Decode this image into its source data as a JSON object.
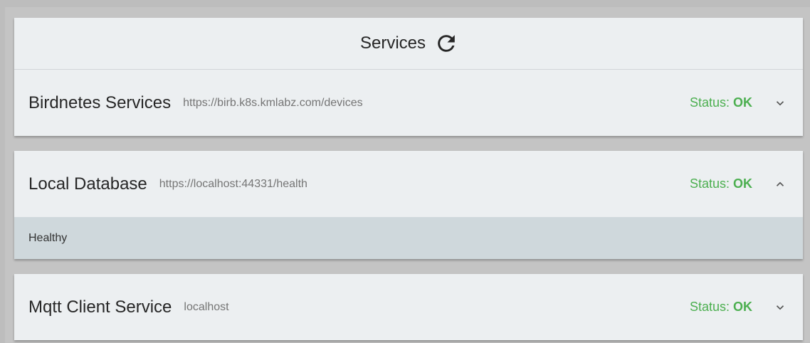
{
  "header": {
    "title": "Services",
    "refresh_icon": "refresh-icon"
  },
  "services": [
    {
      "name": "Birdnetes Services",
      "url": "https://birb.k8s.kmlabz.com/devices",
      "status_label": "Status: ",
      "status_value": "OK",
      "expanded": false,
      "chevron_icon": "chevron-down-icon"
    },
    {
      "name": "Local Database",
      "url": "https://localhost:44331/health",
      "status_label": "Status: ",
      "status_value": "OK",
      "expanded": true,
      "chevron_icon": "chevron-up-icon",
      "detail": "Healthy"
    },
    {
      "name": "Mqtt Client Service",
      "url": "localhost",
      "status_label": "Status: ",
      "status_value": "OK",
      "expanded": false,
      "chevron_icon": "chevron-down-icon"
    }
  ],
  "colors": {
    "status_ok": "#4caf50",
    "card_bg": "#eceff1",
    "detail_bg": "#cfd8dc",
    "page_bg": "#bdbdbd"
  }
}
